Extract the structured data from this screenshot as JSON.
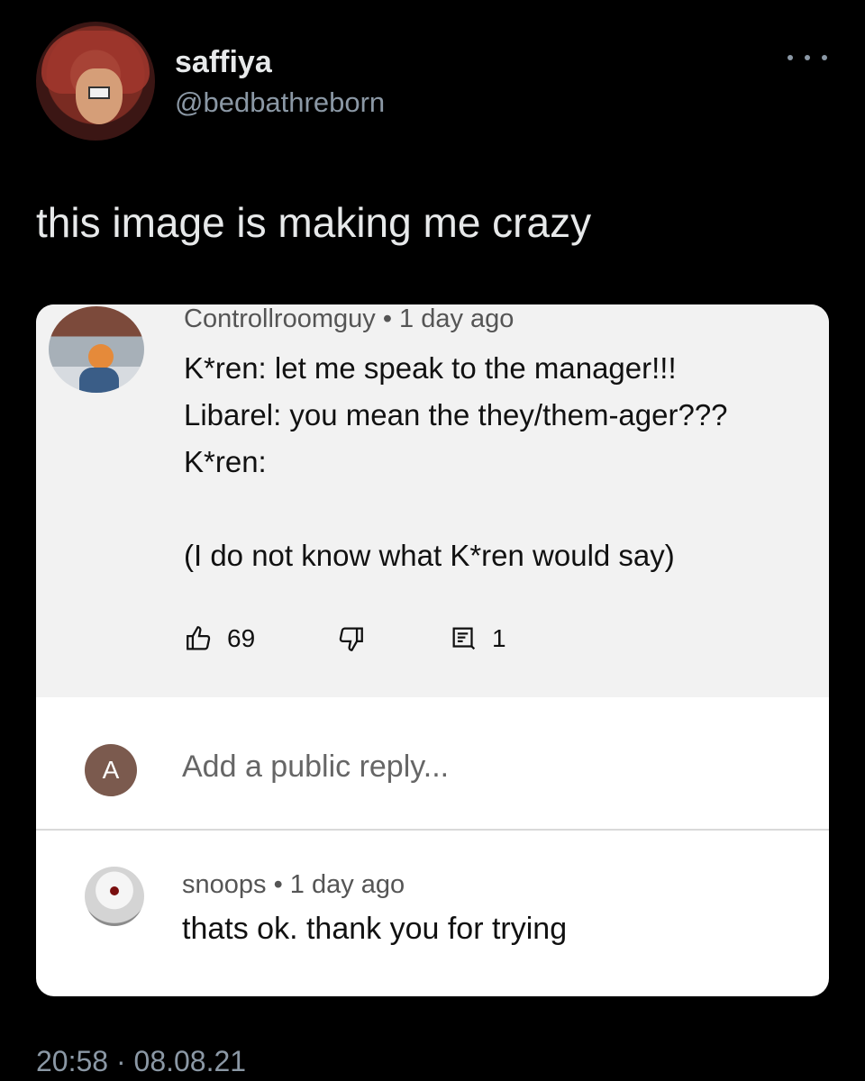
{
  "tweet": {
    "display_name": "saffiya",
    "handle": "@bedbathreborn",
    "text": "this image is making me crazy",
    "timestamp": "20:58 · 08.08.21"
  },
  "comment": {
    "author": "Controllroomguy",
    "age": "1 day ago",
    "lines": [
      "K*ren: let me speak to the manager!!!",
      "Libarel: you mean the they/them-ager???",
      "K*ren:",
      "(I do not know what K*ren would say)"
    ],
    "likes": "69",
    "replies": "1"
  },
  "reply_box": {
    "avatar_letter": "A",
    "placeholder": "Add a public reply..."
  },
  "reply": {
    "author": "snoops",
    "age": "1 day ago",
    "text": "thats ok. thank you for trying"
  }
}
